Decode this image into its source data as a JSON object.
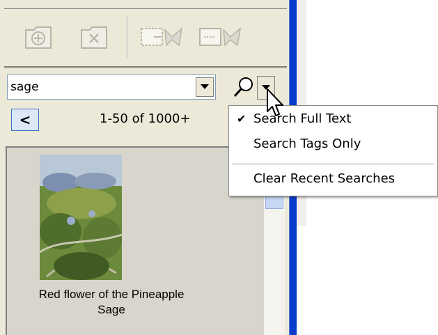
{
  "search": {
    "query": "sage"
  },
  "navigation": {
    "back_label": "<",
    "range_text": "1-50 of 1000+"
  },
  "results": {
    "items": [
      {
        "caption_line1": "Red flower of the Pineapple",
        "caption_line2": "Sage"
      }
    ]
  },
  "menu": {
    "items": [
      {
        "label": "Search Full Text",
        "checked": true
      },
      {
        "label": "Search Tags Only",
        "checked": false
      },
      {
        "label": "Clear Recent Searches",
        "checked": false
      }
    ],
    "check_glyph": "✔"
  },
  "icons": {
    "toolbar": [
      "new-folder-icon",
      "delete-folder-icon",
      "insert-before-icon",
      "insert-after-icon"
    ],
    "search": "magnifier-icon",
    "dropdown": "triangle-down-icon"
  },
  "colors": {
    "panel_bg": "#ece9d8",
    "accent_blue": "#0a3ccc",
    "menu_bg": "#ffffff"
  }
}
